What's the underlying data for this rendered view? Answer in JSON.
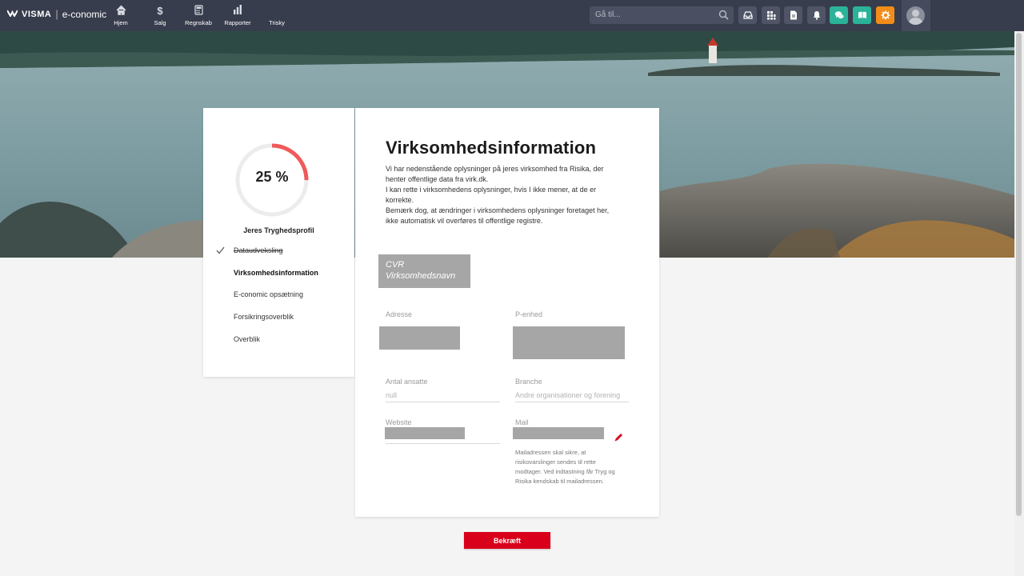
{
  "topbar": {
    "brand": "VISMA",
    "separator": "|",
    "product": "e-conomic",
    "nav": [
      {
        "label": "Hjem",
        "icon": "home-icon"
      },
      {
        "label": "Salg",
        "icon": "dollar-icon"
      },
      {
        "label": "Regnskab",
        "icon": "calculator-icon"
      },
      {
        "label": "Rapporter",
        "icon": "bar-chart-icon"
      },
      {
        "label": "Trisky",
        "icon": ""
      }
    ],
    "search_placeholder": "Gå til...",
    "buttons": [
      "inbox-icon",
      "apps-icon",
      "document-icon",
      "bell-icon",
      "chat-icon",
      "book-icon",
      "gear-icon"
    ]
  },
  "sidebar": {
    "progress_percent": 25,
    "progress_label": "25 %",
    "title": "Jeres Tryghedsprofil",
    "steps": [
      {
        "label": "Dataudveksling",
        "state": "done"
      },
      {
        "label": "Virksomhedsinformation",
        "state": "active"
      },
      {
        "label": "E-conomic opsætning",
        "state": "pending"
      },
      {
        "label": "Forsikringsoverblik",
        "state": "pending"
      },
      {
        "label": "Overblik",
        "state": "pending"
      }
    ]
  },
  "main": {
    "title": "Virksomhedsinformation",
    "description": [
      "Vi har nedenstående oplysninger på jeres virksomhed fra Risika, der",
      "henter offentlige data fra virk.dk.",
      "I kan rette i virksomhedens oplysninger, hvis I ikke mener, at de er",
      "korrekte.",
      "Bemærk dog, at ændringer i virksomhedens oplysninger foretaget her,",
      "ikke automatisk vil overføres til offentlige registre."
    ],
    "cvr_label": "CVR",
    "company_name_label": "Virksomhedsnavn",
    "fields": {
      "address_label": "Adresse",
      "p_unit_label": "P-enhed",
      "employees_label": "Antal ansatte",
      "employees_value": "null",
      "industry_label": "Branche",
      "industry_value": "Andre organisationer og forening",
      "website_label": "Website",
      "mail_label": "Mail"
    },
    "mail_note": [
      "Mailadressen skal sikre, at",
      "risikovarslinger sendes til rette",
      "modtager. Ved indtastning får Tryg og",
      "Risika kendskab til mailadressen."
    ],
    "confirm_label": "Bekræft"
  },
  "colors": {
    "topbar": "#383d4d",
    "accent_red": "#d9001b",
    "progress": "#f05a5a",
    "green_button": "#2bb39a",
    "orange_button": "#f28c1a"
  }
}
